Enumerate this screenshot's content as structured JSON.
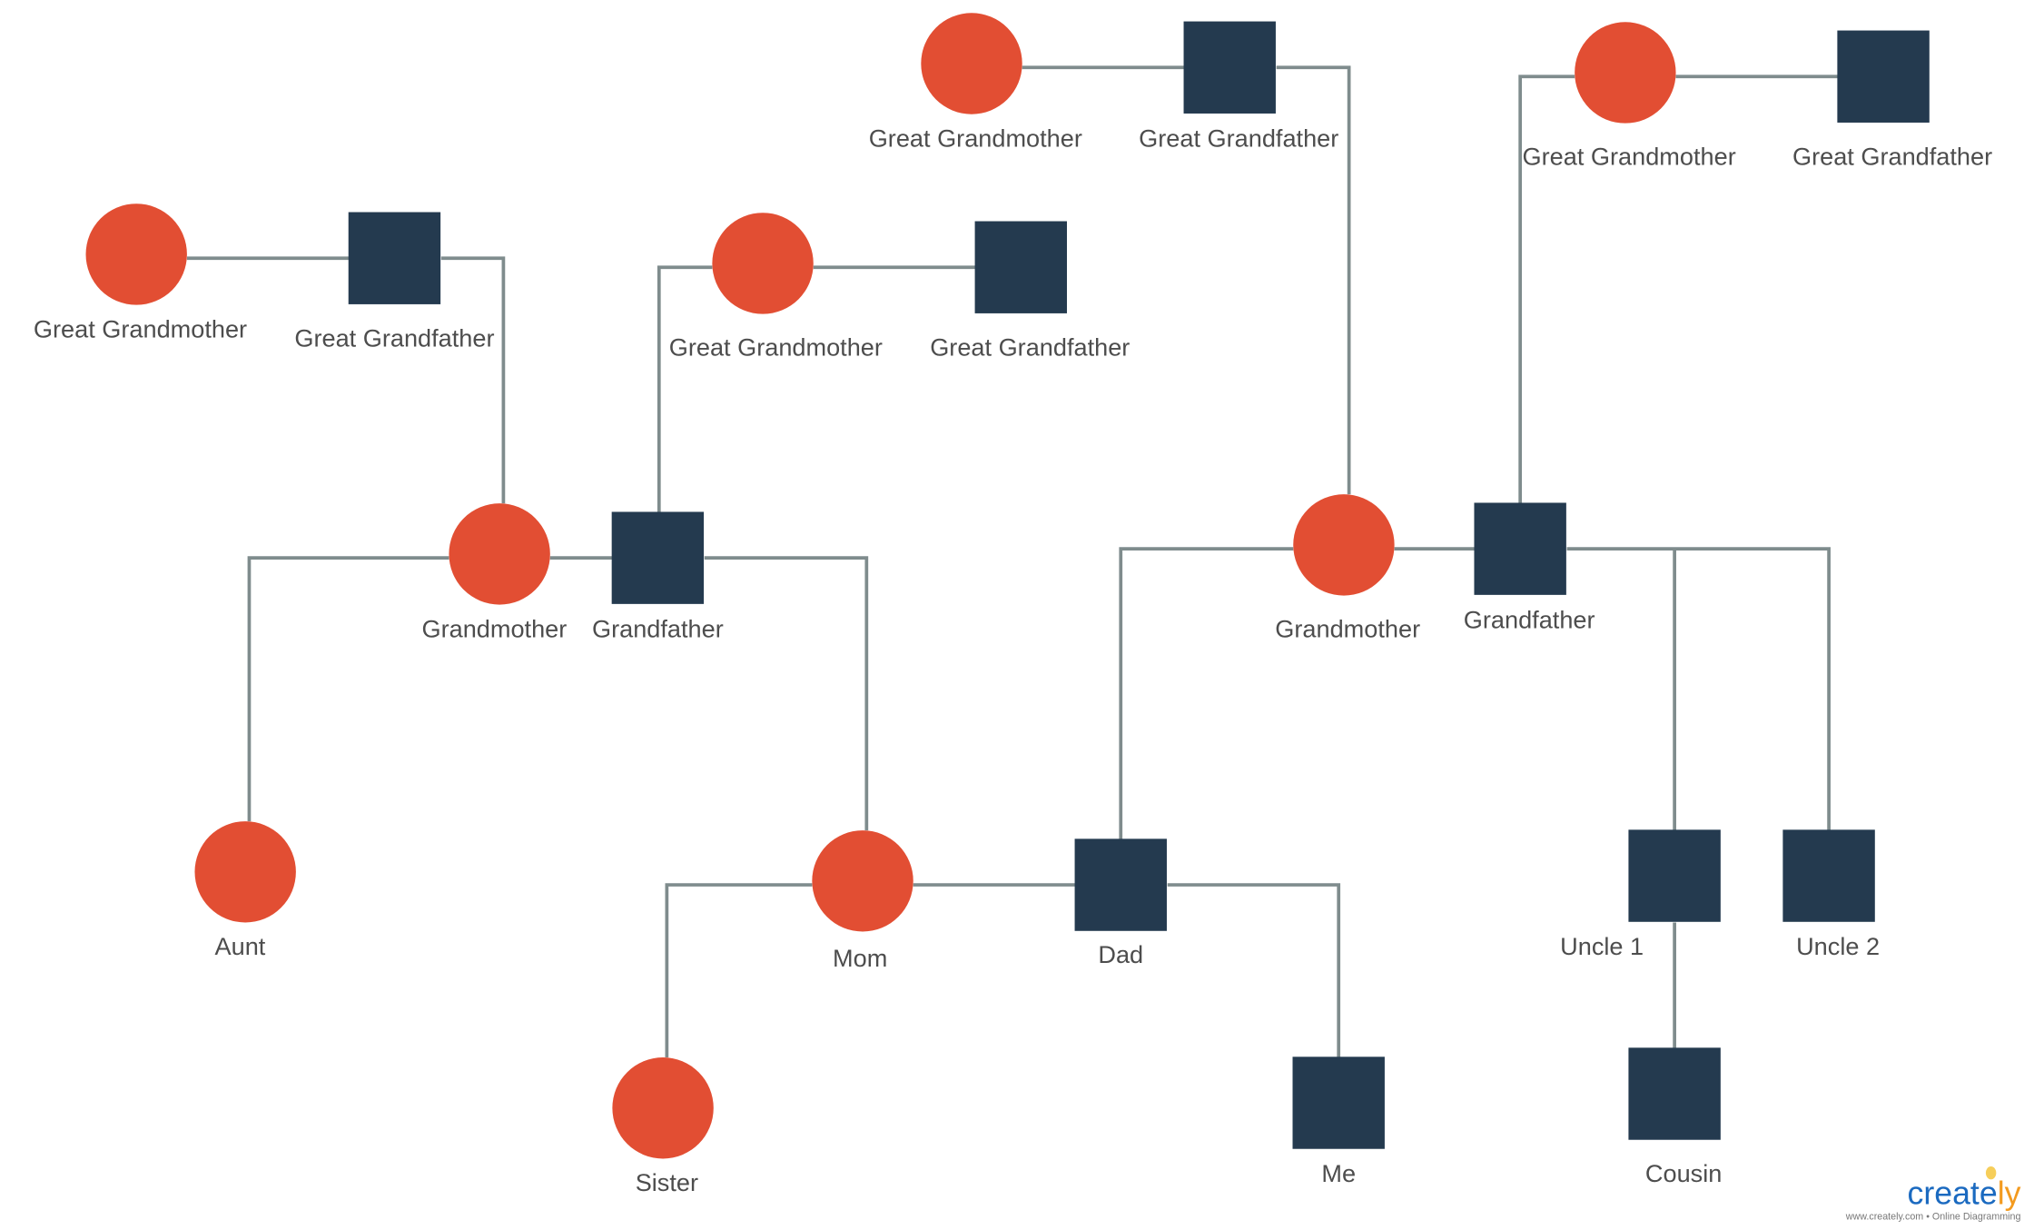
{
  "colors": {
    "female": "#E24E33",
    "male": "#243A4F",
    "line": "#7F8C8D",
    "text": "#4d4d4d",
    "logo_blue": "#1B6AC0",
    "logo_orange": "#F39A1E",
    "bulb": "#F6CE5A"
  },
  "nodes": [
    {
      "id": "ggm1",
      "shape": "circle",
      "label": "Great Grandmother"
    },
    {
      "id": "ggf1",
      "shape": "square",
      "label": "Great Grandfather"
    },
    {
      "id": "ggm2",
      "shape": "circle",
      "label": "Great Grandmother"
    },
    {
      "id": "ggf2",
      "shape": "square",
      "label": "Great Grandfather"
    },
    {
      "id": "ggm3",
      "shape": "circle",
      "label": "Great Grandmother"
    },
    {
      "id": "ggf3",
      "shape": "square",
      "label": "Great Grandfather"
    },
    {
      "id": "ggm4",
      "shape": "circle",
      "label": "Great Grandmother"
    },
    {
      "id": "ggf4",
      "shape": "square",
      "label": "Great Grandfather"
    },
    {
      "id": "gm1",
      "shape": "circle",
      "label": "Grandmother"
    },
    {
      "id": "gf1",
      "shape": "square",
      "label": "Grandfather"
    },
    {
      "id": "gm2",
      "shape": "circle",
      "label": "Grandmother"
    },
    {
      "id": "gf2",
      "shape": "square",
      "label": "Grandfather"
    },
    {
      "id": "aunt",
      "shape": "circle",
      "label": "Aunt"
    },
    {
      "id": "mom",
      "shape": "circle",
      "label": "Mom"
    },
    {
      "id": "dad",
      "shape": "square",
      "label": "Dad"
    },
    {
      "id": "sister",
      "shape": "circle",
      "label": "Sister"
    },
    {
      "id": "me",
      "shape": "square",
      "label": "Me"
    },
    {
      "id": "uncle1",
      "shape": "square",
      "label": "Uncle 1"
    },
    {
      "id": "uncle2",
      "shape": "square",
      "label": "Uncle 2"
    },
    {
      "id": "cousin",
      "shape": "square",
      "label": "Cousin"
    }
  ],
  "logo": {
    "text_blue": "create",
    "text_orange": "ly",
    "tagline": "www.creately.com • Online Diagramming"
  }
}
